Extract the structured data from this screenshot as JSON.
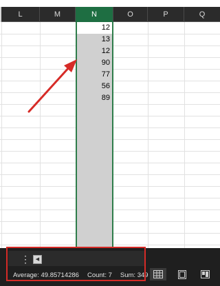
{
  "columns": [
    {
      "label": "L"
    },
    {
      "label": "M"
    },
    {
      "label": "N",
      "selected": true
    },
    {
      "label": "O"
    },
    {
      "label": "P"
    },
    {
      "label": "Q"
    }
  ],
  "column_n_values": [
    "12",
    "13",
    "12",
    "90",
    "77",
    "56",
    "89"
  ],
  "status_bar": {
    "average": "Average: 49.85714286",
    "count": "Count: 7",
    "sum": "Sum: 349"
  },
  "sheet_tabs": {
    "menu_glyph": "⋮",
    "scroll_left_glyph": "◀"
  },
  "view_buttons": [
    {
      "icon": "normal-view-icon",
      "active": true
    },
    {
      "icon": "page-layout-view-icon"
    },
    {
      "icon": "page-break-preview-icon"
    }
  ],
  "colors": {
    "selection_green": "#1e6e42",
    "annotation_red": "#d62b27",
    "selected_fill": "#d0d0d0"
  }
}
